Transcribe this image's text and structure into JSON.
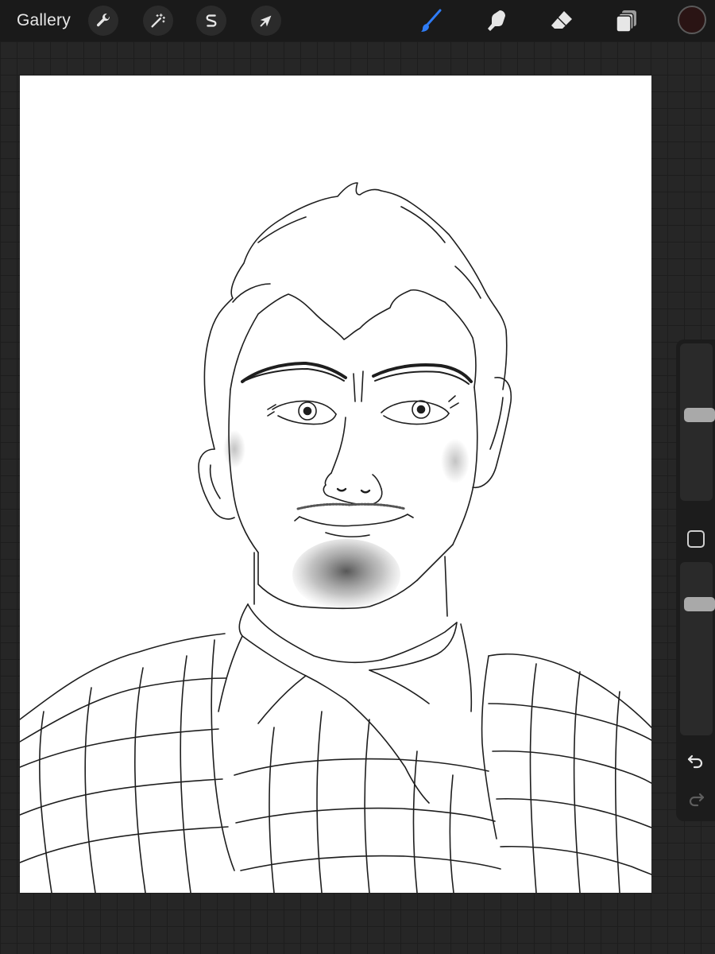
{
  "topbar": {
    "gallery_label": "Gallery",
    "actions": [
      {
        "id": "wrench",
        "icon": "wrench-icon"
      },
      {
        "id": "adjustments",
        "icon": "magic-wand-icon"
      },
      {
        "id": "selection",
        "icon": "selection-s-icon"
      },
      {
        "id": "transform",
        "icon": "arrow-cursor-icon"
      }
    ],
    "tools": [
      {
        "id": "brush",
        "icon": "paintbrush-icon",
        "active": true
      },
      {
        "id": "smudge",
        "icon": "smudge-finger-icon",
        "active": false
      },
      {
        "id": "eraser",
        "icon": "eraser-icon",
        "active": false
      },
      {
        "id": "layers",
        "icon": "layers-icon",
        "active": false
      }
    ],
    "current_color": "#2a1414"
  },
  "colors": {
    "active_tool": "#2f7cf6",
    "icon": "#e6e6e6",
    "slider_handle": "#a9a9a9",
    "canvas": "#ffffff"
  },
  "sidebar": {
    "brush_size": 0.55,
    "brush_opacity": 0.78,
    "modify_icon": "square-modify-icon",
    "undo_icon": "undo-arrow-icon",
    "redo_icon": "redo-arrow-icon",
    "redo_enabled": false
  },
  "canvas": {
    "artwork": "line-art-portrait-icon"
  }
}
